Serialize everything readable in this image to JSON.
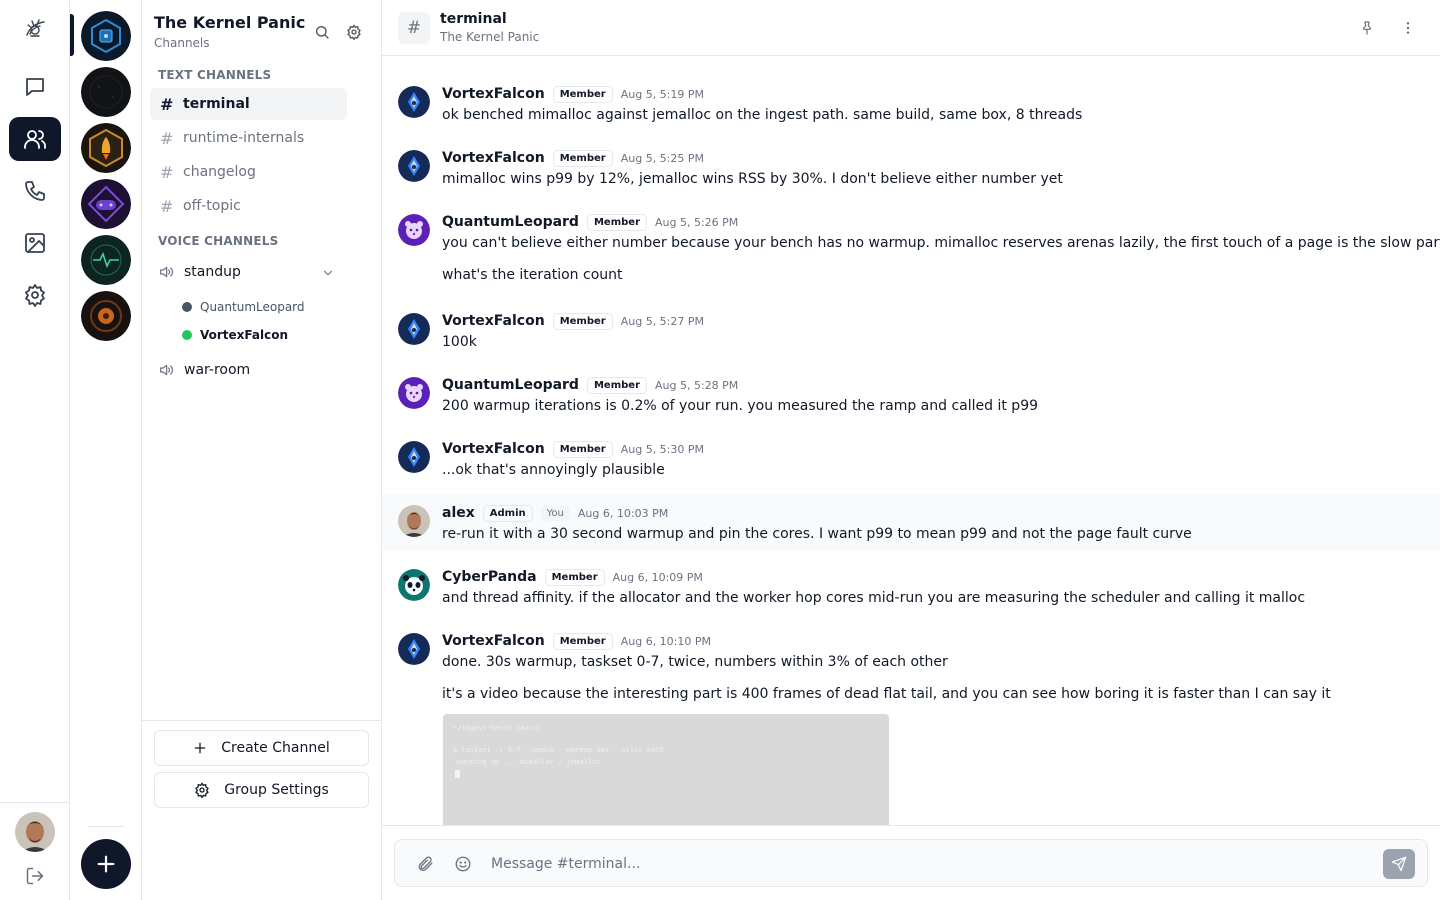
{
  "group": {
    "name": "The Kernel Panic",
    "subtitle": "Channels",
    "text_section": "TEXT CHANNELS",
    "voice_section": "VOICE CHANNELS",
    "text_channels": [
      {
        "name": "terminal",
        "active": true
      },
      {
        "name": "runtime-internals"
      },
      {
        "name": "changelog"
      },
      {
        "name": "off-topic"
      }
    ],
    "voice_channels": [
      {
        "name": "standup",
        "members": [
          {
            "name": "QuantumLeopard",
            "speaking": false
          },
          {
            "name": "VortexFalcon",
            "speaking": true
          }
        ]
      },
      {
        "name": "war-room",
        "members": []
      }
    ],
    "create_channel": "Create Channel",
    "group_settings": "Group Settings"
  },
  "channel": {
    "name": "terminal",
    "group": "The Kernel Panic",
    "placeholder": "Message #terminal..."
  },
  "colors": {
    "accent": "#0f172a",
    "online": "#22c55e",
    "border": "#e5e7eb",
    "muted": "#6b7280"
  },
  "messages": [
    {
      "author": "VortexFalcon",
      "role": "Member",
      "time": "Aug 5, 5:19 PM",
      "lines": [
        "ok benched mimalloc against jemalloc on the ingest path. same build, same box, 8 threads"
      ]
    },
    {
      "author": "VortexFalcon",
      "role": "Member",
      "time": "Aug 5, 5:25 PM",
      "lines": [
        "mimalloc wins p99 by 12%, jemalloc wins RSS by 30%. I don't believe either number yet"
      ]
    },
    {
      "author": "QuantumLeopard",
      "role": "Member",
      "time": "Aug 5, 5:26 PM",
      "lines": [
        "you can't believe either number because your bench has no warmup. mimalloc reserves arenas lazily, the first touch of a page is the slow part",
        "what's the iteration count"
      ]
    },
    {
      "author": "VortexFalcon",
      "role": "Member",
      "time": "Aug 5, 5:27 PM",
      "lines": [
        "100k"
      ]
    },
    {
      "author": "QuantumLeopard",
      "role": "Member",
      "time": "Aug 5, 5:28 PM",
      "lines": [
        "200 warmup iterations is 0.2% of your run. you measured the ramp and called it p99"
      ]
    },
    {
      "author": "VortexFalcon",
      "role": "Member",
      "time": "Aug 5, 5:30 PM",
      "lines": [
        "...ok that's annoyingly plausible"
      ]
    },
    {
      "author": "alex",
      "role": "Admin",
      "you": "You",
      "time": "Aug 6, 10:03 PM",
      "lines": [
        "re-run it with a 30 second warmup and pin the cores. I want p99 to mean p99 and not the page fault curve"
      ]
    },
    {
      "author": "CyberPanda",
      "role": "Member",
      "time": "Aug 6, 10:09 PM",
      "lines": [
        "and thread affinity. if the allocator and the worker hop cores mid-run you are measuring the scheduler and calling it malloc"
      ]
    },
    {
      "author": "VortexFalcon",
      "role": "Member",
      "time": "Aug 6, 10:10 PM",
      "lines": [
        "done. 30s warmup, taskset 0-7, twice, numbers within 3% of each other",
        "it's a video because the interesting part is 400 frames of dead flat tail, and you can see how boring it is faster than I can say it"
      ]
    }
  ],
  "video": {
    "lines": [
      "~/ingest-bench (main)",
      "$ taskset -c 0-7 ./bench --warmup 30s --alloc both",
      "  warming up ...   mimalloc / jemalloc"
    ]
  }
}
